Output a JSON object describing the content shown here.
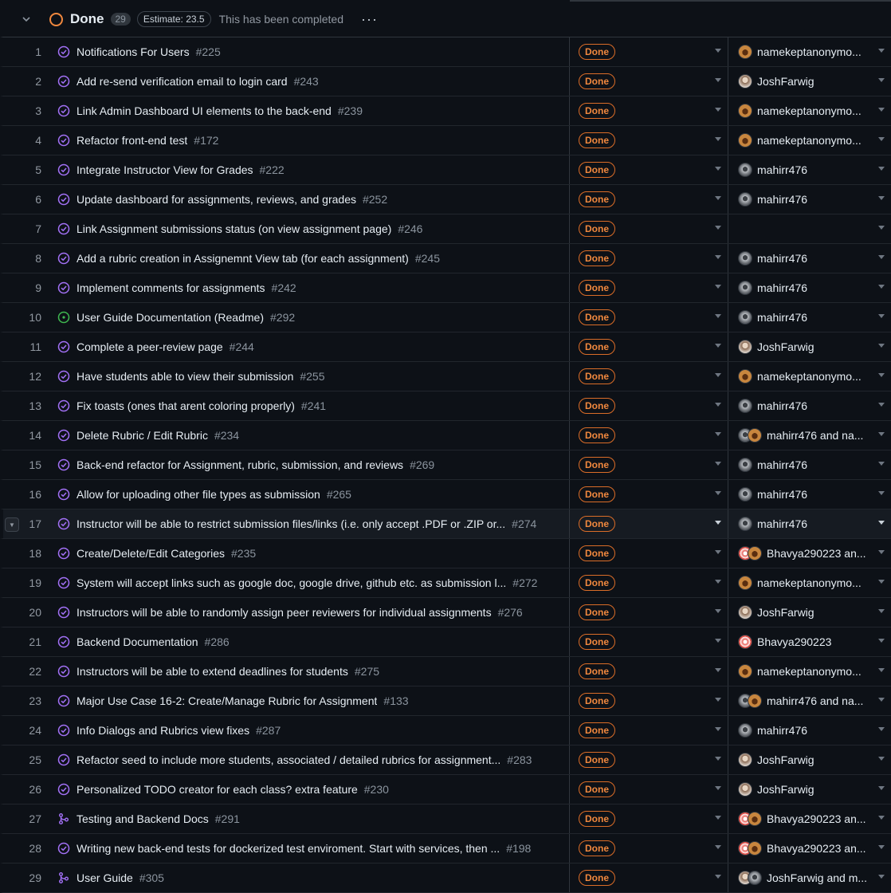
{
  "group": {
    "title": "Done",
    "count": "29",
    "estimate": "Estimate: 23.5",
    "description": "This has been completed",
    "more_label": "···"
  },
  "status_label": "Done",
  "icons": {
    "collapse": "chevron-down-icon",
    "closed": "issue-closed-icon",
    "open": "issue-open-icon",
    "pr": "pull-request-merged-icon"
  },
  "colors": {
    "done": "#f0883e",
    "closed": "#a371f7",
    "open": "#3fb950"
  },
  "rows": [
    {
      "num": "1",
      "icon": "closed",
      "title": "Notifications For Users",
      "issue": "#225",
      "assignee": "namekeptanonymo...",
      "avatars": [
        "anon"
      ]
    },
    {
      "num": "2",
      "icon": "closed",
      "title": "Add re-send verification email to login card",
      "issue": "#243",
      "assignee": "JoshFarwig",
      "avatars": [
        "josh"
      ]
    },
    {
      "num": "3",
      "icon": "closed",
      "title": "Link Admin Dashboard UI elements to the back-end",
      "issue": "#239",
      "assignee": "namekeptanonymo...",
      "avatars": [
        "anon"
      ]
    },
    {
      "num": "4",
      "icon": "closed",
      "title": "Refactor front-end test",
      "issue": "#172",
      "assignee": "namekeptanonymo...",
      "avatars": [
        "anon"
      ]
    },
    {
      "num": "5",
      "icon": "closed",
      "title": "Integrate Instructor View for Grades",
      "issue": "#222",
      "assignee": "mahirr476",
      "avatars": [
        "mahir"
      ]
    },
    {
      "num": "6",
      "icon": "closed",
      "title": "Update dashboard for assignments, reviews, and grades",
      "issue": "#252",
      "assignee": "mahirr476",
      "avatars": [
        "mahir"
      ]
    },
    {
      "num": "7",
      "icon": "closed",
      "title": "Link Assignment submissions status (on view assignment page)",
      "issue": "#246",
      "assignee": "",
      "avatars": []
    },
    {
      "num": "8",
      "icon": "closed",
      "title": "Add a rubric creation in Assignemnt View tab (for each assignment)",
      "issue": "#245",
      "assignee": "mahirr476",
      "avatars": [
        "mahir"
      ]
    },
    {
      "num": "9",
      "icon": "closed",
      "title": "Implement comments for assignments",
      "issue": "#242",
      "assignee": "mahirr476",
      "avatars": [
        "mahir"
      ]
    },
    {
      "num": "10",
      "icon": "open",
      "title": "User Guide Documentation (Readme)",
      "issue": "#292",
      "assignee": "mahirr476",
      "avatars": [
        "mahir"
      ]
    },
    {
      "num": "11",
      "icon": "closed",
      "title": "Complete a peer-review page",
      "issue": "#244",
      "assignee": "JoshFarwig",
      "avatars": [
        "josh"
      ]
    },
    {
      "num": "12",
      "icon": "closed",
      "title": "Have students able to view their submission",
      "issue": "#255",
      "assignee": "namekeptanonymo...",
      "avatars": [
        "anon"
      ]
    },
    {
      "num": "13",
      "icon": "closed",
      "title": "Fix toasts (ones that arent coloring properly)",
      "issue": "#241",
      "assignee": "mahirr476",
      "avatars": [
        "mahir"
      ]
    },
    {
      "num": "14",
      "icon": "closed",
      "title": "Delete Rubric / Edit Rubric",
      "issue": "#234",
      "assignee": "mahirr476 and na...",
      "avatars": [
        "mahir",
        "anon"
      ]
    },
    {
      "num": "15",
      "icon": "closed",
      "title": "Back-end refactor for Assignment, rubric, submission, and reviews",
      "issue": "#269",
      "assignee": "mahirr476",
      "avatars": [
        "mahir"
      ]
    },
    {
      "num": "16",
      "icon": "closed",
      "title": "Allow for uploading other file types as submission",
      "issue": "#265",
      "assignee": "mahirr476",
      "avatars": [
        "mahir"
      ]
    },
    {
      "num": "17",
      "icon": "closed",
      "title": "Instructor will be able to restrict submission files/links (i.e. only accept .PDF or .ZIP or...",
      "issue": "#274",
      "assignee": "mahirr476",
      "avatars": [
        "mahir"
      ],
      "selected": true
    },
    {
      "num": "18",
      "icon": "closed",
      "title": "Create/Delete/Edit Categories",
      "issue": "#235",
      "assignee": "Bhavya290223 an...",
      "avatars": [
        "bhavya",
        "anon"
      ]
    },
    {
      "num": "19",
      "icon": "closed",
      "title": "System will accept links such as google doc, google drive, github etc. as submission l...",
      "issue": "#272",
      "assignee": "namekeptanonymo...",
      "avatars": [
        "anon"
      ]
    },
    {
      "num": "20",
      "icon": "closed",
      "title": "Instructors will be able to randomly assign peer reviewers for individual assignments",
      "issue": "#276",
      "assignee": "JoshFarwig",
      "avatars": [
        "josh"
      ]
    },
    {
      "num": "21",
      "icon": "closed",
      "title": "Backend Documentation",
      "issue": "#286",
      "assignee": "Bhavya290223",
      "avatars": [
        "bhavya"
      ]
    },
    {
      "num": "22",
      "icon": "closed",
      "title": "Instructors will be able to extend deadlines for students",
      "issue": "#275",
      "assignee": "namekeptanonymo...",
      "avatars": [
        "anon"
      ]
    },
    {
      "num": "23",
      "icon": "closed",
      "title": "Major Use Case 16-2: Create/Manage Rubric for Assignment",
      "issue": "#133",
      "assignee": "mahirr476 and na...",
      "avatars": [
        "mahir",
        "anon"
      ]
    },
    {
      "num": "24",
      "icon": "closed",
      "title": "Info Dialogs and Rubrics view fixes",
      "issue": "#287",
      "assignee": "mahirr476",
      "avatars": [
        "mahir"
      ]
    },
    {
      "num": "25",
      "icon": "closed",
      "title": "Refactor seed to include more students, associated / detailed rubrics for assignment...",
      "issue": "#283",
      "assignee": "JoshFarwig",
      "avatars": [
        "josh"
      ]
    },
    {
      "num": "26",
      "icon": "closed",
      "title": "Personalized TODO creator for each class? extra feature",
      "issue": "#230",
      "assignee": "JoshFarwig",
      "avatars": [
        "josh"
      ]
    },
    {
      "num": "27",
      "icon": "pr",
      "title": "Testing and Backend Docs",
      "issue": "#291",
      "assignee": "Bhavya290223 an...",
      "avatars": [
        "bhavya",
        "anon"
      ]
    },
    {
      "num": "28",
      "icon": "closed",
      "title": "Writing new back-end tests for dockerized test enviroment. Start with services, then ...",
      "issue": "#198",
      "assignee": "Bhavya290223 an...",
      "avatars": [
        "bhavya",
        "anon"
      ]
    },
    {
      "num": "29",
      "icon": "pr",
      "title": "User Guide",
      "issue": "#305",
      "assignee": "JoshFarwig and m...",
      "avatars": [
        "josh",
        "mahir"
      ]
    }
  ]
}
